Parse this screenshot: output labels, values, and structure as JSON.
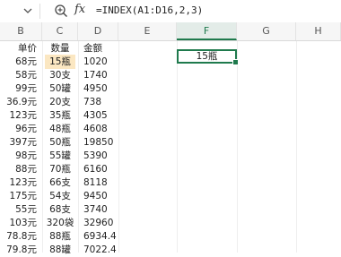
{
  "formula_bar": {
    "chevron_icon": "chevron-down-icon",
    "zoom_icon": "zoom-search-icon",
    "fx_label": "fx",
    "formula": "=INDEX(A1:D16,2,3)"
  },
  "columns": [
    "B",
    "C",
    "D",
    "E",
    "F",
    "G",
    "H"
  ],
  "active_column": "F",
  "header_row": {
    "price": "单价",
    "qty": "数量",
    "amount": "金额"
  },
  "rows": [
    {
      "price": "68元",
      "qty": "15瓶",
      "amount": "1020"
    },
    {
      "price": "58元",
      "qty": "30支",
      "amount": "1740"
    },
    {
      "price": "99元",
      "qty": "50罐",
      "amount": "4950"
    },
    {
      "price": "36.9元",
      "qty": "20支",
      "amount": "738"
    },
    {
      "price": "123元",
      "qty": "35瓶",
      "amount": "4305"
    },
    {
      "price": "96元",
      "qty": "48瓶",
      "amount": "4608"
    },
    {
      "price": "397元",
      "qty": "50瓶",
      "amount": "19850"
    },
    {
      "price": "98元",
      "qty": "55罐",
      "amount": "5390"
    },
    {
      "price": "88元",
      "qty": "70瓶",
      "amount": "6160"
    },
    {
      "price": "123元",
      "qty": "66支",
      "amount": "8118"
    },
    {
      "price": "175元",
      "qty": "54支",
      "amount": "9450"
    },
    {
      "price": "55元",
      "qty": "68支",
      "amount": "3740"
    },
    {
      "price": "103元",
      "qty": "320袋",
      "amount": "32960"
    },
    {
      "price": "78.8元",
      "qty": "88瓶",
      "amount": "6934.4"
    },
    {
      "price": "79.8元",
      "qty": "88罐",
      "amount": "7022.4"
    }
  ],
  "selected_cell": {
    "ref": "F2",
    "value": "15瓶"
  },
  "colors": {
    "accent": "#1f7a4d",
    "highlight": "#fbe7c2"
  }
}
